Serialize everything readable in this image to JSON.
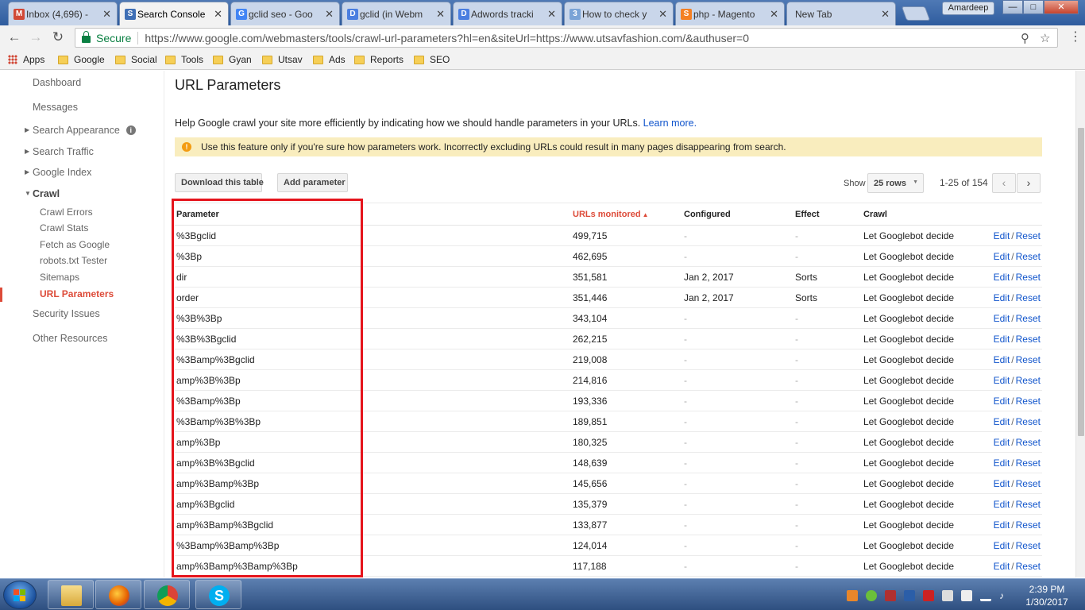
{
  "browser": {
    "tabs": [
      {
        "label": "Inbox (4,696) -",
        "icon": "gmail-icon",
        "color": "#d14836",
        "glyph": "M"
      },
      {
        "label": "Search Console",
        "icon": "search-console-icon",
        "color": "#3f6fb5",
        "glyph": "S"
      },
      {
        "label": "gclid seo - Goo",
        "icon": "google-icon",
        "color": "#4285f4",
        "glyph": "G"
      },
      {
        "label": "gclid (in Webm",
        "icon": "docs-icon",
        "color": "#4a7ee0",
        "glyph": "D"
      },
      {
        "label": "Adwords tracki",
        "icon": "docs-icon",
        "color": "#4a7ee0",
        "glyph": "D"
      },
      {
        "label": "How to check y",
        "icon": "quora-icon",
        "color": "#7aa3d6",
        "glyph": "3"
      },
      {
        "label": "php - Magento",
        "icon": "stackoverflow-icon",
        "color": "#f48024",
        "glyph": "S"
      },
      {
        "label": "New Tab",
        "icon": "",
        "color": "",
        "glyph": ""
      }
    ],
    "profile_name": "Amardeep",
    "secure_label": "Secure",
    "url": "https://www.google.com/webmasters/tools/crawl-url-parameters?hl=en&siteUrl=https://www.utsavfashion.com/&authuser=0",
    "bookmarks": [
      "Apps",
      "Google",
      "Social",
      "Tools",
      "Gyan",
      "Utsav",
      "Ads",
      "Reports",
      "SEO"
    ]
  },
  "sidebar": {
    "dashboard": "Dashboard",
    "messages": "Messages",
    "search_appearance": "Search Appearance",
    "search_traffic": "Search Traffic",
    "google_index": "Google Index",
    "crawl": "Crawl",
    "crawl_items": [
      "Crawl Errors",
      "Crawl Stats",
      "Fetch as Google",
      "robots.txt Tester",
      "Sitemaps",
      "URL Parameters"
    ],
    "security_issues": "Security Issues",
    "other_resources": "Other Resources"
  },
  "main": {
    "title": "URL Parameters",
    "help_text": "Help Google crawl your site more efficiently by indicating how we should handle parameters in your URLs.",
    "learn_more": "Learn more.",
    "warning": "Use this feature only if you're sure how parameters work. Incorrectly excluding URLs could result in many pages disappearing from search.",
    "download_button": "Download this table",
    "add_button": "Add parameter",
    "show_label": "Show",
    "rows_select": "25 rows",
    "range": "1-25 of 154",
    "columns": [
      "Parameter",
      "URLs monitored",
      "Configured",
      "Effect",
      "Crawl"
    ],
    "edit_label": "Edit",
    "slash": "/",
    "reset_label": "Reset",
    "rows": [
      {
        "param": "%3Bgclid",
        "urls": "499,715",
        "configured": "-",
        "effect": "-",
        "crawl": "Let Googlebot decide"
      },
      {
        "param": "%3Bp",
        "urls": "462,695",
        "configured": "-",
        "effect": "-",
        "crawl": "Let Googlebot decide"
      },
      {
        "param": "dir",
        "urls": "351,581",
        "configured": "Jan 2, 2017",
        "effect": "Sorts",
        "crawl": "Let Googlebot decide"
      },
      {
        "param": "order",
        "urls": "351,446",
        "configured": "Jan 2, 2017",
        "effect": "Sorts",
        "crawl": "Let Googlebot decide"
      },
      {
        "param": "%3B%3Bp",
        "urls": "343,104",
        "configured": "-",
        "effect": "-",
        "crawl": "Let Googlebot decide"
      },
      {
        "param": "%3B%3Bgclid",
        "urls": "262,215",
        "configured": "-",
        "effect": "-",
        "crawl": "Let Googlebot decide"
      },
      {
        "param": "%3Bamp%3Bgclid",
        "urls": "219,008",
        "configured": "-",
        "effect": "-",
        "crawl": "Let Googlebot decide"
      },
      {
        "param": "amp%3B%3Bp",
        "urls": "214,816",
        "configured": "-",
        "effect": "-",
        "crawl": "Let Googlebot decide"
      },
      {
        "param": "%3Bamp%3Bp",
        "urls": "193,336",
        "configured": "-",
        "effect": "-",
        "crawl": "Let Googlebot decide"
      },
      {
        "param": "%3Bamp%3B%3Bp",
        "urls": "189,851",
        "configured": "-",
        "effect": "-",
        "crawl": "Let Googlebot decide"
      },
      {
        "param": "amp%3Bp",
        "urls": "180,325",
        "configured": "-",
        "effect": "-",
        "crawl": "Let Googlebot decide"
      },
      {
        "param": "amp%3B%3Bgclid",
        "urls": "148,639",
        "configured": "-",
        "effect": "-",
        "crawl": "Let Googlebot decide"
      },
      {
        "param": "amp%3Bamp%3Bp",
        "urls": "145,656",
        "configured": "-",
        "effect": "-",
        "crawl": "Let Googlebot decide"
      },
      {
        "param": "amp%3Bgclid",
        "urls": "135,379",
        "configured": "-",
        "effect": "-",
        "crawl": "Let Googlebot decide"
      },
      {
        "param": "amp%3Bamp%3Bgclid",
        "urls": "133,877",
        "configured": "-",
        "effect": "-",
        "crawl": "Let Googlebot decide"
      },
      {
        "param": "%3Bamp%3Bamp%3Bp",
        "urls": "124,014",
        "configured": "-",
        "effect": "-",
        "crawl": "Let Googlebot decide"
      },
      {
        "param": "amp%3Bamp%3Bamp%3Bp",
        "urls": "117,188",
        "configured": "-",
        "effect": "-",
        "crawl": "Let Googlebot decide"
      }
    ]
  },
  "taskbar": {
    "time": "2:39 PM",
    "date": "1/30/2017"
  },
  "colors": {
    "accent_red": "#dd4b39",
    "link_blue": "#1155cc",
    "warning_bg": "#f9edbe",
    "highlight_box": "#e5141c"
  }
}
